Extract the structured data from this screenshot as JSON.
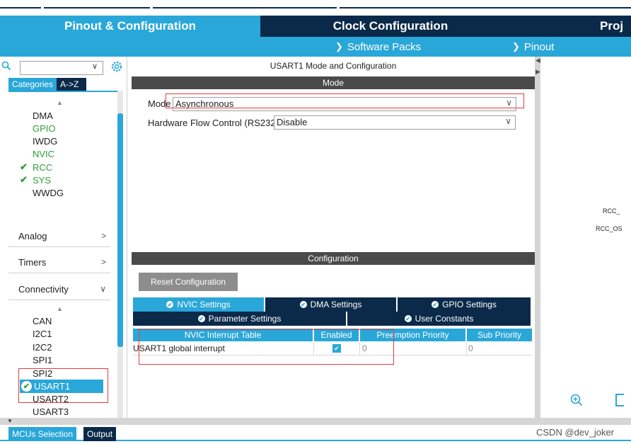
{
  "main_tabs": [
    {
      "label": "Pinout & Configuration",
      "active": true
    },
    {
      "label": "Clock Configuration",
      "active": false
    },
    {
      "label": "Proj",
      "active": false
    }
  ],
  "sub_tabs": [
    {
      "label": "Software Packs"
    },
    {
      "label": "Pinout"
    }
  ],
  "sidebar": {
    "search_value": "",
    "category_tabs": [
      "Categories",
      "A->Z"
    ],
    "system_core_items": [
      {
        "label": "DMA",
        "checked": false,
        "color": "default"
      },
      {
        "label": "GPIO",
        "checked": false,
        "color": "green"
      },
      {
        "label": "IWDG",
        "checked": false,
        "color": "default"
      },
      {
        "label": "NVIC",
        "checked": false,
        "color": "green"
      },
      {
        "label": "RCC",
        "checked": true,
        "color": "green"
      },
      {
        "label": "SYS",
        "checked": true,
        "color": "green"
      },
      {
        "label": "WWDG",
        "checked": false,
        "color": "default"
      }
    ],
    "sections": [
      "Analog",
      "Timers",
      "Connectivity"
    ],
    "connectivity_items": [
      "CAN",
      "I2C1",
      "I2C2",
      "SPI1",
      "SPI2",
      "USART1",
      "USART2",
      "USART3"
    ],
    "selected_item": "USART1"
  },
  "mode_panel": {
    "title": "USART1 Mode and Configuration",
    "mode_header": "Mode",
    "mode_label": "Mode",
    "mode_value": "Asynchronous",
    "hwflow_label": "Hardware Flow Control (RS232)",
    "hwflow_value": "Disable"
  },
  "config_panel": {
    "header": "Configuration",
    "reset_button": "Reset Configuration",
    "tabs_row1": [
      "NVIC Settings",
      "DMA Settings",
      "GPIO Settings"
    ],
    "tabs_row2": [
      "Parameter Settings",
      "User Constants"
    ],
    "active_tab": "NVIC Settings",
    "table_columns": [
      "NVIC Interrupt Table",
      "Enabled",
      "Preemption Priority",
      "Sub Priority"
    ],
    "table_rows": [
      {
        "name": "USART1 global interrupt",
        "enabled": true,
        "preemption": "0",
        "sub": "0"
      }
    ]
  },
  "pinout_view": {
    "labels": [
      "RCC_",
      "RCC_OS"
    ]
  },
  "bottom_tabs": [
    "MCUs Selection",
    "Output"
  ],
  "watermark": "CSDN @dev_joker",
  "colors": {
    "accent": "#2aa7d9",
    "navy": "#0b2a4a",
    "green": "#2e9e3a",
    "highlight_red": "#e23d3d"
  }
}
